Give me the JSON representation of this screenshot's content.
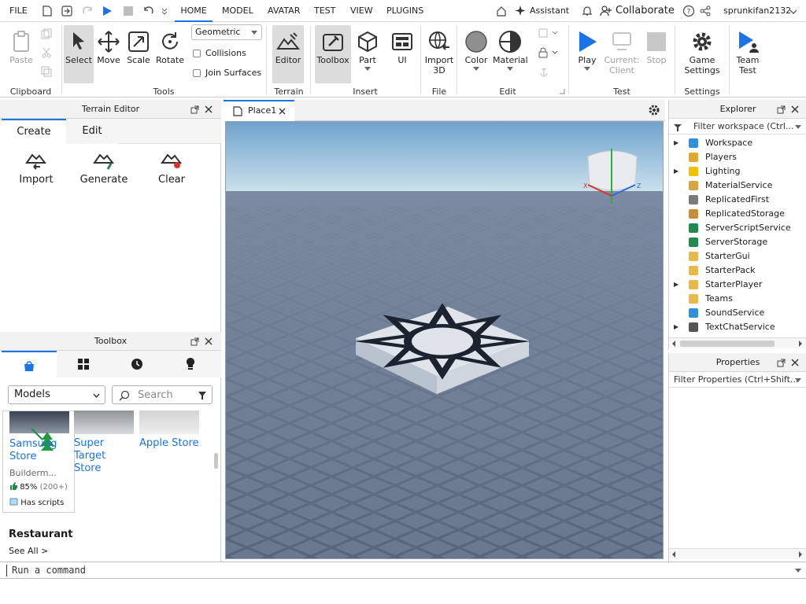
{
  "menu": {
    "file": "FILE",
    "tabs": [
      "HOME",
      "MODEL",
      "AVATAR",
      "TEST",
      "VIEW",
      "PLUGINS"
    ],
    "active_tab": "HOME",
    "assistant": "Assistant",
    "collaborate": "Collaborate",
    "username": "sprunkifan2132"
  },
  "ribbon": {
    "clipboard": {
      "paste": "Paste",
      "label": "Clipboard"
    },
    "tools": {
      "select": "Select",
      "move": "Move",
      "scale": "Scale",
      "rotate": "Rotate",
      "mode": "Geometric",
      "collisions": "Collisions",
      "join_surfaces": "Join Surfaces",
      "label": "Tools"
    },
    "terrain": {
      "editor": "Editor",
      "label": "Terrain"
    },
    "insert": {
      "toolbox": "Toolbox",
      "part": "Part",
      "ui": "UI",
      "label": "Insert"
    },
    "file": {
      "import3d_line1": "Import",
      "import3d_line2": "3D",
      "label": "File"
    },
    "edit": {
      "color": "Color",
      "material": "Material",
      "label": "Edit"
    },
    "test": {
      "play": "Play",
      "current_line1": "Current:",
      "current_line2": "Client",
      "stop": "Stop",
      "label": "Test"
    },
    "settings": {
      "game_line1": "Game",
      "game_line2": "Settings",
      "label": "Settings"
    },
    "team": {
      "line1": "Team",
      "line2": "Test"
    }
  },
  "terrain_editor": {
    "title": "Terrain Editor",
    "tabs": [
      "Create",
      "Edit"
    ],
    "active_tab": "Create",
    "tools": [
      "Import",
      "Generate",
      "Clear"
    ]
  },
  "toolbox": {
    "title": "Toolbox",
    "category": "Models",
    "search_placeholder": "Search",
    "items": [
      {
        "name_line1": "Samsung",
        "name_line2": "Store",
        "author": "Builderm...",
        "rating": "85%",
        "votes": "(200+)",
        "scripts": "Has scripts"
      },
      {
        "name_line1": "Super Target",
        "name_line2": "Store"
      },
      {
        "name_line1": "Apple Store",
        "name_line2": ""
      }
    ],
    "section": "Restaurant",
    "see_all": "See All >"
  },
  "viewport": {
    "tab": "Place1"
  },
  "explorer": {
    "title": "Explorer",
    "filter_placeholder": "Filter workspace (Ctrl...",
    "items": [
      {
        "label": "Workspace",
        "expandable": true,
        "color": "#2f8fd8"
      },
      {
        "label": "Players",
        "expandable": false,
        "color": "#e0a82e"
      },
      {
        "label": "Lighting",
        "expandable": true,
        "color": "#f2c200"
      },
      {
        "label": "MaterialService",
        "expandable": false,
        "color": "#d9a441"
      },
      {
        "label": "ReplicatedFirst",
        "expandable": false,
        "color": "#7a7a7a"
      },
      {
        "label": "ReplicatedStorage",
        "expandable": false,
        "color": "#c98c3a"
      },
      {
        "label": "ServerScriptService",
        "expandable": false,
        "color": "#1f8a4c"
      },
      {
        "label": "ServerStorage",
        "expandable": false,
        "color": "#1f8a4c"
      },
      {
        "label": "StarterGui",
        "expandable": false,
        "color": "#e9b94a"
      },
      {
        "label": "StarterPack",
        "expandable": false,
        "color": "#e9b94a"
      },
      {
        "label": "StarterPlayer",
        "expandable": true,
        "color": "#e9b94a"
      },
      {
        "label": "Teams",
        "expandable": false,
        "color": "#e9b94a"
      },
      {
        "label": "SoundService",
        "expandable": false,
        "color": "#2f8fd8"
      },
      {
        "label": "TextChatService",
        "expandable": true,
        "color": "#555555"
      }
    ]
  },
  "properties": {
    "title": "Properties",
    "filter_placeholder": "Filter Properties (Ctrl+Shift..."
  },
  "command_bar": {
    "placeholder": "Run a command"
  },
  "colors": {
    "accent": "#1a73e8",
    "play": "#1a73e8",
    "sky_top": "#79abd0",
    "ground": "#5c6c86"
  }
}
